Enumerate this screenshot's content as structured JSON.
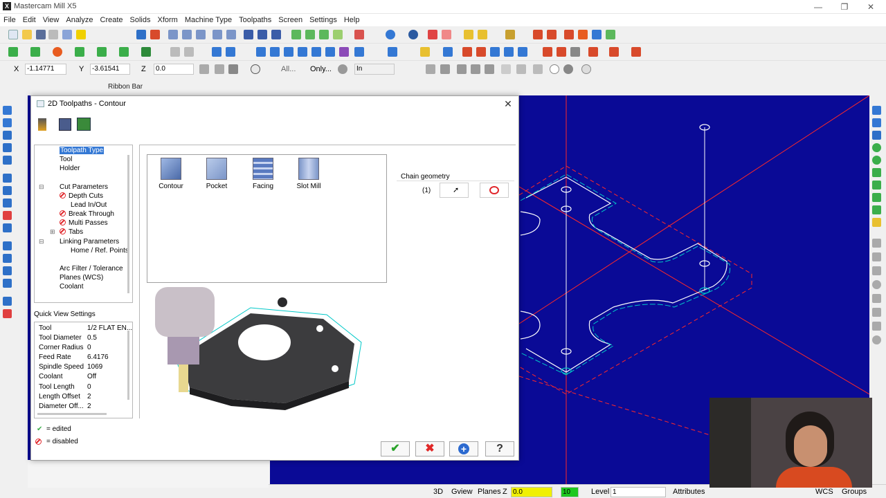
{
  "window": {
    "title": "Mastercam Mill X5",
    "controls": {
      "minimize": "—",
      "maximize": "❐",
      "close": "✕"
    }
  },
  "menu": [
    "File",
    "Edit",
    "View",
    "Analyze",
    "Create",
    "Solids",
    "Xform",
    "Machine Type",
    "Toolpaths",
    "Screen",
    "Settings",
    "Help"
  ],
  "ribbon": {
    "x_label": "X",
    "x_value": "-1.14771",
    "y_label": "Y",
    "y_value": "-3.61541",
    "z_label": "Z",
    "z_value": "0.0",
    "all_label": "All...",
    "only_label": "Only...",
    "in_value": "In",
    "caption": "Ribbon Bar"
  },
  "dialog": {
    "title": "2D Toolpaths - Contour",
    "tree": [
      {
        "label": "Toolpath Type",
        "selected": true
      },
      {
        "label": "Tool"
      },
      {
        "label": "Holder"
      },
      {
        "label": "Cut Parameters"
      },
      {
        "label": "Depth Cuts",
        "disabled": true
      },
      {
        "label": "Lead In/Out"
      },
      {
        "label": "Break Through",
        "disabled": true
      },
      {
        "label": "Multi Passes",
        "disabled": true
      },
      {
        "label": "Tabs",
        "disabled": true
      },
      {
        "label": "Linking Parameters"
      },
      {
        "label": "Home / Ref. Points"
      },
      {
        "label": "Arc Filter / Tolerance"
      },
      {
        "label": "Planes (WCS)"
      },
      {
        "label": "Coolant"
      }
    ],
    "quick_view_title": "Quick View Settings",
    "quick_view": [
      {
        "k": "Tool",
        "v": "1/2 FLAT EN..."
      },
      {
        "k": "Tool Diameter",
        "v": "0.5"
      },
      {
        "k": "Corner Radius",
        "v": "0"
      },
      {
        "k": "Feed Rate",
        "v": "6.4176"
      },
      {
        "k": "Spindle Speed",
        "v": "1069"
      },
      {
        "k": "Coolant",
        "v": "Off"
      },
      {
        "k": "Tool Length",
        "v": "0"
      },
      {
        "k": "Length Offset",
        "v": "2"
      },
      {
        "k": "Diameter Off...",
        "v": "2"
      }
    ],
    "legend_edited": "= edited",
    "legend_disabled": "= disabled",
    "toolpath_types": [
      "Contour",
      "Pocket",
      "Facing",
      "Slot Mill"
    ],
    "chain_geometry_label": "Chain geometry",
    "chain_count": "(1)",
    "buttons": {
      "ok": "✔",
      "cancel": "✖",
      "add": "+",
      "help": "?"
    }
  },
  "status": {
    "mode_3d": "3D",
    "gview": "Gview",
    "planes": "Planes",
    "z_label": "Z",
    "z_value": "0.0",
    "color_value": "10",
    "level_label": "Level",
    "level_value": "1",
    "attributes": "Attributes",
    "wcs": "WCS",
    "groups": "Groups"
  },
  "colors": {
    "graphics_bg": "#0a0a96",
    "geometry": "#ffffff",
    "axis": "#ff2020",
    "toolpath": "#00c8c8",
    "selection": "#3478d4"
  }
}
